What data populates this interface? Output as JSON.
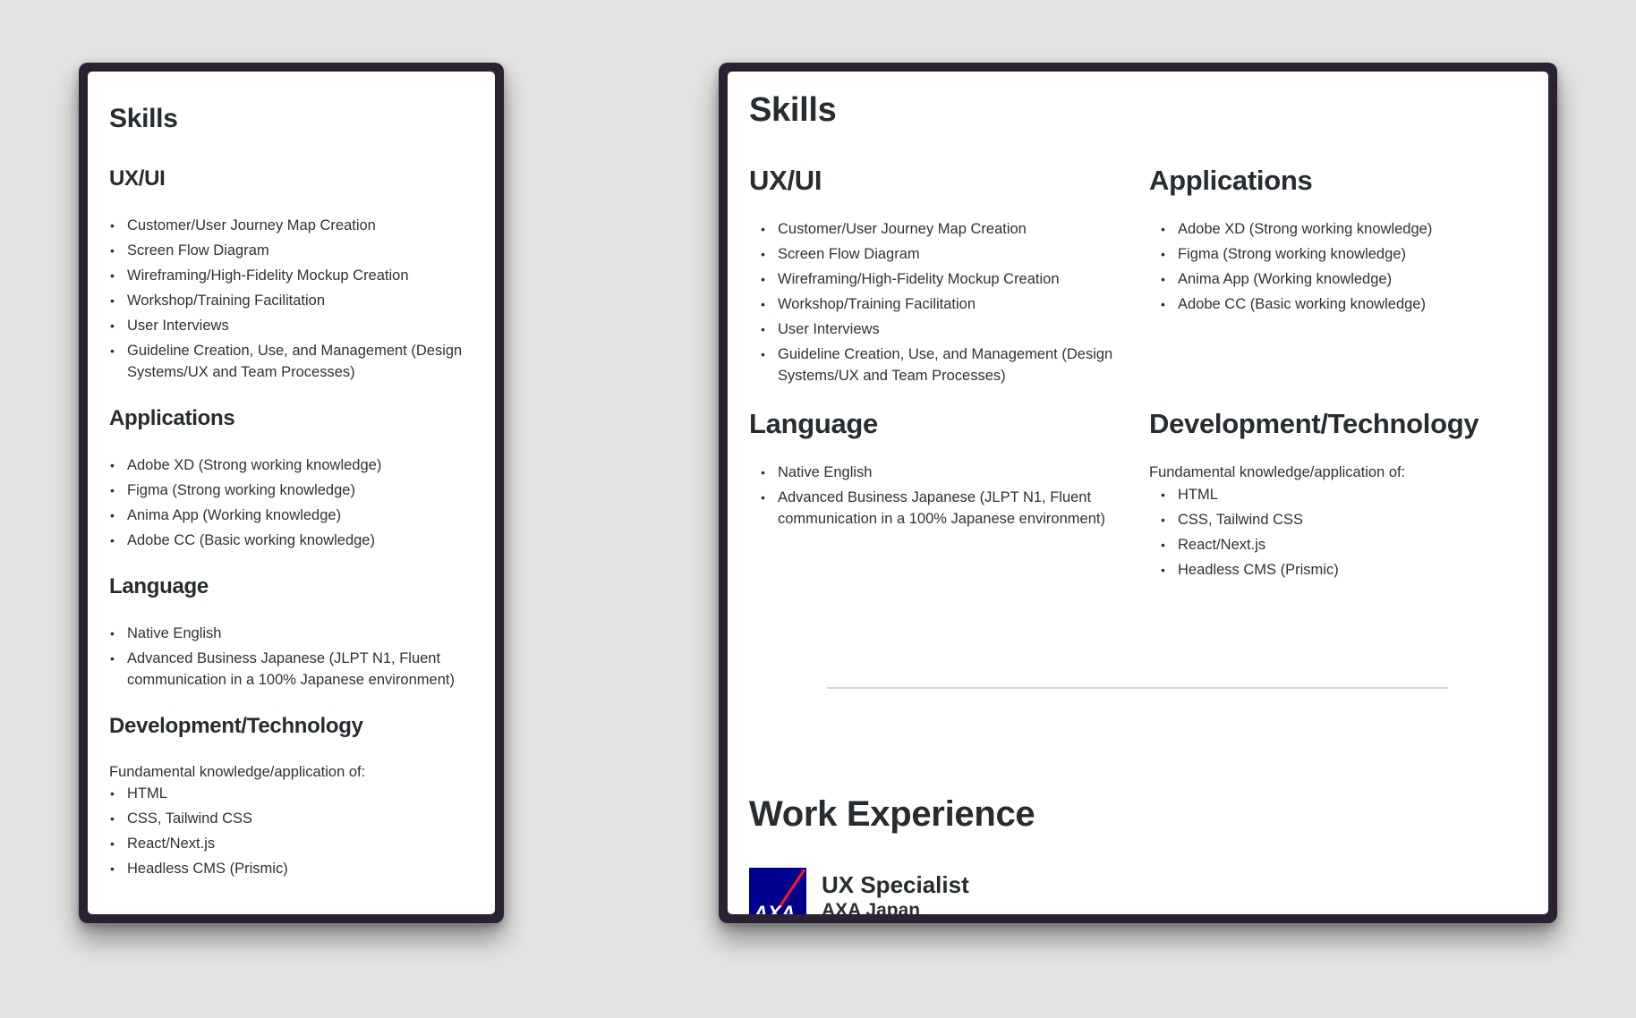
{
  "left_view": {
    "title": "Skills",
    "sections": {
      "uxui": {
        "heading": "UX/UI",
        "items": [
          "Customer/User Journey Map Creation",
          "Screen Flow Diagram",
          "Wireframing/High-Fidelity Mockup Creation",
          "Workshop/Training Facilitation",
          "User Interviews",
          "Guideline Creation, Use, and Management (Design",
          "Systems/UX and Team Processes)"
        ]
      },
      "applications": {
        "heading": "Applications",
        "items": [
          "Adobe XD (Strong working knowledge)",
          "Figma (Strong working knowledge)",
          "Anima App (Working knowledge)",
          "Adobe CC (Basic working knowledge)"
        ]
      },
      "language": {
        "heading": "Language",
        "items": [
          "Native English",
          "Advanced Business Japanese (JLPT N1, Fluent",
          "communication in a 100% Japanese environment)"
        ]
      },
      "development": {
        "heading": "Development/Technology",
        "intro": "Fundamental knowledge/application of:",
        "items": [
          "HTML",
          "CSS, Tailwind CSS",
          "React/Next.js",
          "Headless CMS (Prismic)"
        ]
      }
    }
  },
  "right_view": {
    "title": "Skills",
    "sections": {
      "uxui": {
        "heading": "UX/UI",
        "items": [
          "Customer/User Journey Map Creation",
          "Screen Flow Diagram",
          "Wireframing/High-Fidelity Mockup Creation",
          "Workshop/Training Facilitation",
          "User Interviews",
          "Guideline Creation, Use, and Management (Design",
          "Systems/UX and Team Processes)"
        ]
      },
      "applications": {
        "heading": "Applications",
        "items": [
          "Adobe XD (Strong working knowledge)",
          "Figma (Strong working knowledge)",
          "Anima App (Working knowledge)",
          "Adobe CC (Basic working knowledge)"
        ]
      },
      "language": {
        "heading": "Language",
        "items": [
          "Native English",
          "Advanced Business Japanese (JLPT N1, Fluent",
          "communication in a 100% Japanese environment)"
        ]
      },
      "development": {
        "heading": "Development/Technology",
        "intro": "Fundamental knowledge/application of:",
        "items": [
          "HTML",
          "CSS, Tailwind CSS",
          "React/Next.js",
          "Headless CMS (Prismic)"
        ]
      }
    },
    "work_experience": {
      "heading": "Work Experience",
      "jobs": [
        {
          "title": "UX Specialist",
          "company": "AXA Japan",
          "logo_text": "AXA",
          "logo_icon": "axa-logo-icon"
        }
      ]
    }
  },
  "colors": {
    "background": "#e3e3e3",
    "device_frame": "#2a2232",
    "text": "#2b2f33",
    "divider": "#d4d7d8",
    "axa_blue": "#00008f",
    "axa_red": "#ff1721"
  }
}
